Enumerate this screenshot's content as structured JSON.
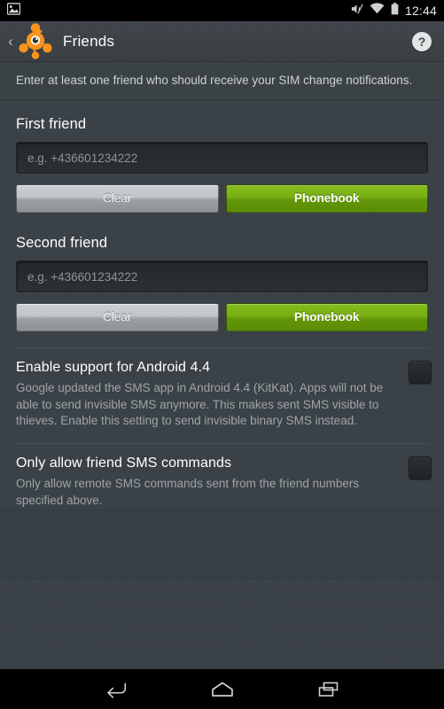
{
  "status_bar": {
    "notification_icon": "image-icon",
    "silent_icon": "volume-mute-icon",
    "wifi_icon": "wifi-icon",
    "battery_icon": "battery-icon",
    "clock": "12:44"
  },
  "action_bar": {
    "back_icon": "back-chevron-icon",
    "app_logo": "avast-logo-icon",
    "title": "Friends",
    "help_icon": "help-icon",
    "help_label": "?"
  },
  "intro": {
    "text": "Enter at least one friend who should receive your SIM change notifications."
  },
  "friends": [
    {
      "label": "First friend",
      "value": "",
      "placeholder": "e.g. +436601234222",
      "clear_label": "Clear",
      "phonebook_label": "Phonebook"
    },
    {
      "label": "Second friend",
      "value": "",
      "placeholder": "e.g. +436601234222",
      "clear_label": "Clear",
      "phonebook_label": "Phonebook"
    }
  ],
  "preferences": [
    {
      "title": "Enable support for Android 4.4",
      "summary": "Google updated the SMS app in Android 4.4 (KitKat). Apps will not be able to send invisible SMS anymore. This makes sent SMS visible to thieves. Enable this setting to send invisible binary SMS instead.",
      "checked": false
    },
    {
      "title": "Only allow friend SMS commands",
      "summary": "Only allow remote SMS commands sent from the friend numbers specified above.",
      "checked": false
    }
  ],
  "nav_bar": {
    "back_icon": "navigation-back-icon",
    "home_icon": "navigation-home-icon",
    "recents_icon": "navigation-recents-icon"
  },
  "colors": {
    "accent_green": "#78ae12",
    "brand_orange": "#f89a1c",
    "background": "#3b4247",
    "action_bar": "#3d4449"
  }
}
